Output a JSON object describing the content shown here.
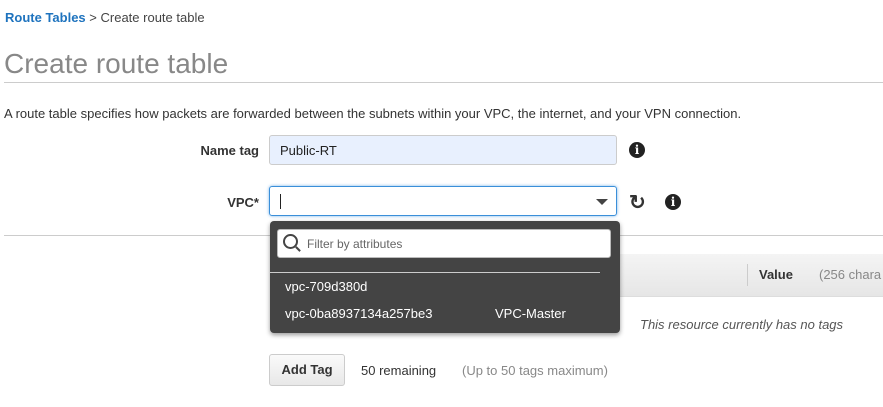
{
  "breadcrumb": {
    "parent": "Route Tables",
    "separator": " > ",
    "current": "Create route table"
  },
  "title": "Create route table",
  "description": "A route table specifies how packets are forwarded between the subnets within your VPC, the internet, and your VPN connection.",
  "form": {
    "name_label": "Name tag",
    "name_value": "Public-RT",
    "vpc_label": "VPC*",
    "vpc_value": ""
  },
  "dropdown": {
    "filter_placeholder": "Filter by attributes",
    "options": [
      {
        "id": "vpc-709d380d",
        "name": ""
      },
      {
        "id": "vpc-0ba8937134a257be3",
        "name": "VPC-Master"
      }
    ]
  },
  "tags": {
    "value_header": "Value",
    "value_hint": "(256 chara",
    "empty": "This resource currently has no tags",
    "add_label": "Add Tag",
    "remaining": "50 remaining",
    "max": "(Up to 50 tags maximum)"
  }
}
